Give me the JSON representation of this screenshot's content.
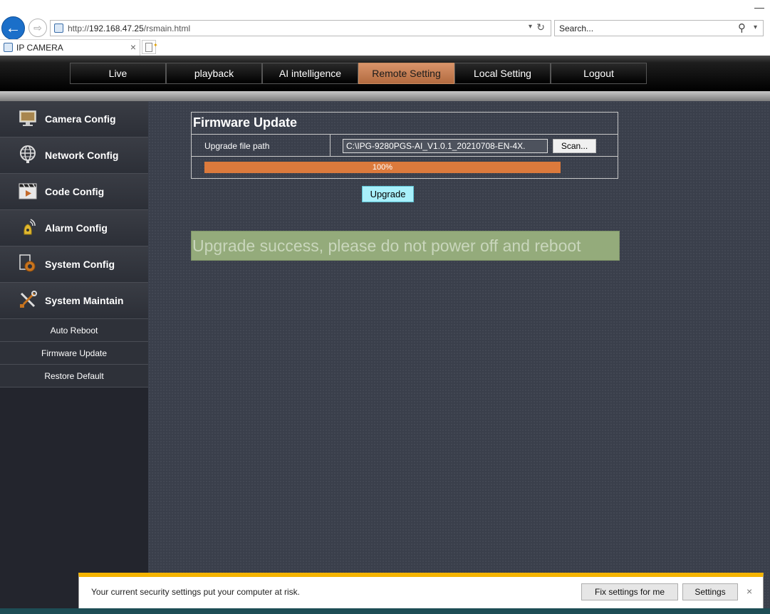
{
  "browser": {
    "address": {
      "prefix": "http://",
      "host": "192.168.47.25",
      "path": "/rsmain.html"
    },
    "search_placeholder": "Search...",
    "tab_title": "IP CAMERA",
    "tab_close": "×",
    "minimize": "—",
    "back_icon": "back-arrow-icon",
    "forward_icon": "forward-arrow-icon"
  },
  "nav": {
    "items": [
      "Live",
      "playback",
      "AI intelligence",
      "Remote Setting",
      "Local Setting",
      "Logout"
    ],
    "active_index": 3,
    "active_color": "#c98b60"
  },
  "sidebar": {
    "items": [
      {
        "label": "Camera Config",
        "icon": "monitor-icon"
      },
      {
        "label": "Network Config",
        "icon": "globe-icon"
      },
      {
        "label": "Code Config",
        "icon": "film-clapper-icon"
      },
      {
        "label": "Alarm Config",
        "icon": "alarm-bell-icon"
      },
      {
        "label": "System Config",
        "icon": "gear-icon"
      },
      {
        "label": "System Maintain",
        "icon": "tools-icon"
      }
    ],
    "subitems": [
      "Auto Reboot",
      "Firmware Update",
      "Restore Default"
    ]
  },
  "firmware": {
    "title": "Firmware Update",
    "path_label": "Upgrade file path",
    "path_value": "C:\\IPG-9280PGS-AI_V1.0.1_20210708-EN-4X.",
    "scan_label": "Scan...",
    "progress": 1.0,
    "progress_label": "100%",
    "progress_color": "#dc7a3c",
    "upgrade_label": "Upgrade",
    "success_message": "Upgrade success, please do not power off and reboot"
  },
  "notification": {
    "message": "Your current security settings put your computer at risk.",
    "fix_label": "Fix settings for me",
    "settings_label": "Settings",
    "close": "×",
    "accent_color": "#f5b400"
  }
}
